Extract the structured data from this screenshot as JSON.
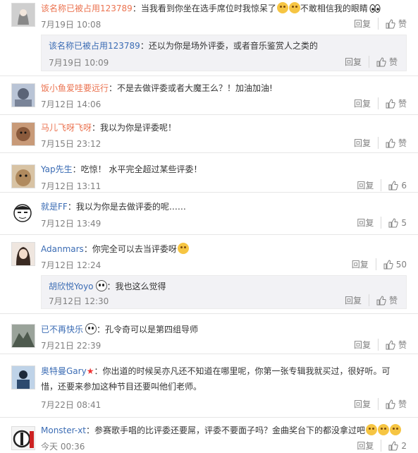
{
  "labels": {
    "reply": "回复",
    "like": "赞"
  },
  "comments": [
    {
      "user": "该名称已被占用123789",
      "text": "当我看到你坐在选手席位时我惊呆了",
      "text2": "不敢相信我的眼睛",
      "time": "7月19日 10:08",
      "like": "赞",
      "reply": {
        "user": "该名称已被占用123789",
        "text": "还以为你是场外评委，或者音乐鉴赏人之类的",
        "time": "7月19日 10:09",
        "like": "赞"
      }
    },
    {
      "user": "饭小鱼爱哇要远行",
      "text": "不是去做评委或者大魔王么？！加油加油!",
      "time": "7月12日 14:06",
      "like": "赞"
    },
    {
      "user": "马儿飞呀飞呀",
      "text": "我以为你是评委呢！",
      "time": "7月15日 23:12",
      "like": "赞"
    },
    {
      "user": "Yap先生",
      "text": "吃惊！ 水平完全超过某些评委！",
      "time": "7月12日 13:11",
      "like": "6"
    },
    {
      "user": "就是FF",
      "text": "我以为你是去做评委的呢……",
      "time": "7月12日 13:49",
      "like": "5"
    },
    {
      "user": "Adanmars",
      "text": "你完全可以去当评委呀",
      "time": "7月12日 12:24",
      "like": "50",
      "reply": {
        "user": "胡欣悦Yoyo",
        "text": "我也这么觉得",
        "time": "7月12日 12:30",
        "like": "赞"
      }
    },
    {
      "user": "已不再快乐",
      "text": "孔令奇可以是第四组导师",
      "time": "7月21日 22:39",
      "like": "赞"
    },
    {
      "user": "奥特曼Gary",
      "text": "你出道的时候吴亦凡还不知道在哪里呢，你第一张专辑我就买过，很好听。可",
      "text_line2": "惜，还要来参加这种节目还要叫他们老师。",
      "time": "7月22日 08:41",
      "like": "赞"
    },
    {
      "user": "Monster-xt",
      "text": "参赛歌手唱的比评委还要屌，评委不要面子吗？金曲奖台下的都没拿过吧",
      "time": "今天 00:36",
      "like": "2"
    }
  ]
}
